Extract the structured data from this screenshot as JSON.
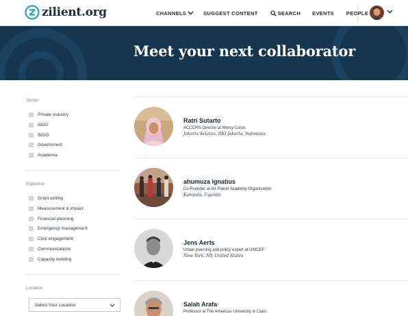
{
  "brand": {
    "name": "zilient.org",
    "color": "#1c2d3e",
    "accent": "#1fa5b8"
  },
  "nav": {
    "channels": "CHANNELS",
    "suggest": "SUGGEST CONTENT",
    "search": "SEARCH",
    "events": "EVENTS",
    "people": "PEOPLE"
  },
  "hero": {
    "title": "Meet your next collaborator",
    "background": "#163650"
  },
  "filters": {
    "sector": {
      "label": "Sector",
      "options": [
        "Private Industry",
        "NGO",
        "INGO",
        "Government",
        "Academia"
      ]
    },
    "expertise": {
      "label": "Expertise",
      "options": [
        "Grant writing",
        "Measurement & impact",
        "Financial planning",
        "Emergency management",
        "Civic engagement",
        "Communications",
        "Capacity building"
      ]
    },
    "location": {
      "label": "Location",
      "select_value": "Select Your Location"
    }
  },
  "people": [
    {
      "name": "Ratri Sutarto",
      "role": "ACCCRN Director at Mercy Corps",
      "location": "Jakarta Selatan, DKI Jakarta, Indonesia",
      "avatar": "woman-hijab-photo"
    },
    {
      "name": "ahumuza ignatius",
      "role": "Co-Founder at Art Planet Academy Organization",
      "location": "Kampala, Uganda",
      "avatar": "group-photo"
    },
    {
      "name": "Jens Aerts",
      "role": "Urban planning and policy expert at UNICEF",
      "location": "New York, NY, United States",
      "avatar": "man-bw-photo"
    },
    {
      "name": "Salah Arafa",
      "role": "Professor at The American University in Cairo",
      "location": "",
      "avatar": "man-gray-hair-photo"
    }
  ]
}
